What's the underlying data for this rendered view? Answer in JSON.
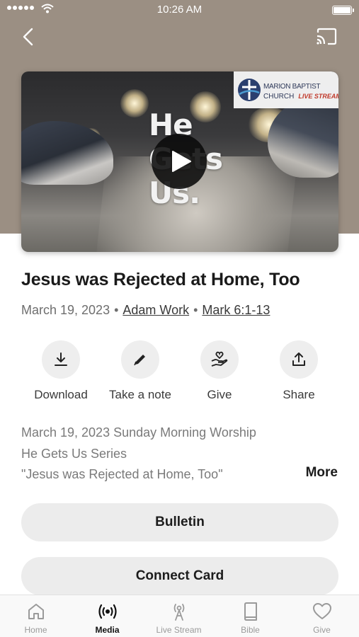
{
  "status_bar": {
    "time": "10:26 AM"
  },
  "video": {
    "title_art_lines": [
      "He",
      "Gets",
      "Us."
    ],
    "logo": {
      "org_line1": "MARION BAPTIST",
      "org_line2": "CHURCH",
      "tag": "LIVE STREAM"
    }
  },
  "sermon": {
    "title": "Jesus was Rejected at Home, Too",
    "date": "March 19, 2023",
    "speaker": "Adam Work",
    "scripture": "Mark 6:1-13"
  },
  "actions": [
    {
      "label": "Download",
      "icon": "download-icon"
    },
    {
      "label": "Take a note",
      "icon": "pencil-icon"
    },
    {
      "label": "Give",
      "icon": "giving-hand-heart-icon"
    },
    {
      "label": "Share",
      "icon": "share-icon"
    }
  ],
  "description": {
    "lines": [
      "March 19, 2023 Sunday Morning Worship",
      "He Gets Us Series",
      "\"Jesus was Rejected at Home, Too\""
    ],
    "more_label": "More"
  },
  "buttons": {
    "bulletin": "Bulletin",
    "connect_card": "Connect Card"
  },
  "tab_bar": {
    "active": "Media",
    "tabs": [
      {
        "label": "Home",
        "icon": "home-icon"
      },
      {
        "label": "Media",
        "icon": "broadcast-icon"
      },
      {
        "label": "Live Stream",
        "icon": "antenna-icon"
      },
      {
        "label": "Bible",
        "icon": "book-icon"
      },
      {
        "label": "Give",
        "icon": "heart-icon"
      }
    ]
  },
  "colors": {
    "hero_bg": "#9b8f83",
    "pill_bg": "#ececec",
    "text_dark": "#1c1c1c",
    "text_muted": "#6e6e6e"
  }
}
